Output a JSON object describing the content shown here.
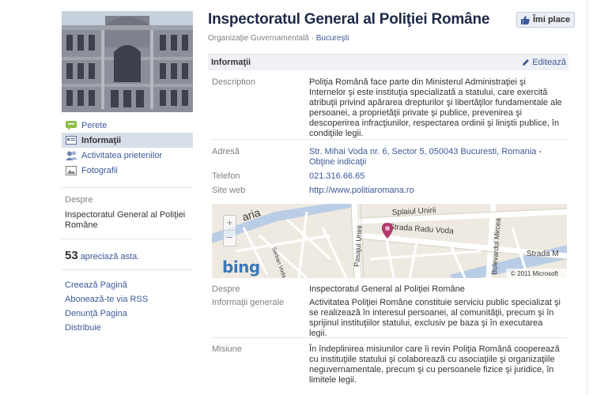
{
  "page": {
    "title": "Inspectoratul General al Poliţiei Române",
    "like_button": "Îmi place",
    "category": "Organizaţie Guvernamentală",
    "separator": "·",
    "location": "Bucureşti"
  },
  "nav": {
    "items": [
      {
        "label": "Perete",
        "icon": "wall-icon",
        "color": "#8fbd49"
      },
      {
        "label": "Informaţii",
        "icon": "info-icon",
        "color": "#5a6f9a"
      },
      {
        "label": "Activitatea prietenilor",
        "icon": "friends-icon",
        "color": "#6d84b4"
      },
      {
        "label": "Fotografii",
        "icon": "photos-icon",
        "color": "#7f7f7f"
      }
    ]
  },
  "sidebar": {
    "despre_heading": "Despre",
    "despre_text": "Inspectoratul General al Poliţiei Române",
    "likes_count": "53",
    "likes_text": "apreciază asta.",
    "links": [
      "Creează Pagină",
      "Abonează-te via RSS",
      "Denunţă Pagina",
      "Distribuie"
    ]
  },
  "info": {
    "heading": "Informaţii",
    "edit_label": "Editează",
    "description_label": "Description",
    "description_text": "Poliţia Română face parte din Ministerul Administraţiei şi Internelor şi este instituţia specializată a statului, care exercită atribuţii privind apărarea drepturilor şi libertăţilor fundamentale ale persoanei, a proprietăţii private şi publice, prevenirea şi descoperirea infracţiunilor, respectarea ordinii şi liniştii publice, în condiţiile legii.",
    "address_label": "Adresă",
    "address_value": "Str. Mihai Voda nr. 6, Sector 5, 050043 Bucuresti, Romania",
    "address_link": "Obţine indicaţii",
    "phone_label": "Telefon",
    "phone_value": "021.316.66.65",
    "website_label": "Site web",
    "website_value": "http://www.politiaromana.ro",
    "despre_label": "Despre",
    "despre_value": "Inspectoratul General al Poliţiei Române",
    "general_label": "Informaţii generale",
    "general_value": "Activitatea Poliţiei Române constituie serviciu public specializat şi se realizează în interesul persoanei, al comunităţii, precum şi în sprijinul instituţiilor statului, exclusiv pe baza şi în executarea legii.",
    "mission_label": "Misiune",
    "mission_value": "În îndeplinirea misiunilor care îi revin Poliţia Română cooperează cu instituţiile statului şi colaborează cu asociaţiile şi organizaţiile neguvernamentale, precum şi cu persoanele fizice şi juridice, în limitele legii."
  },
  "map": {
    "logo": "bing",
    "copyright": "© 2011 Microsoft",
    "zoom_in": "+",
    "zoom_out": "−",
    "streets": [
      "Splaiul Unirii",
      "Strada Radu Voda",
      "Pasajul Unirii",
      "Bulevardul Mircea",
      "Strada M",
      "Serban Voda",
      "aria"
    ]
  },
  "colors": {
    "link": "#3b5998",
    "title": "#1c2a47",
    "pin": "#b23a6b",
    "river": "#b9cde6"
  }
}
